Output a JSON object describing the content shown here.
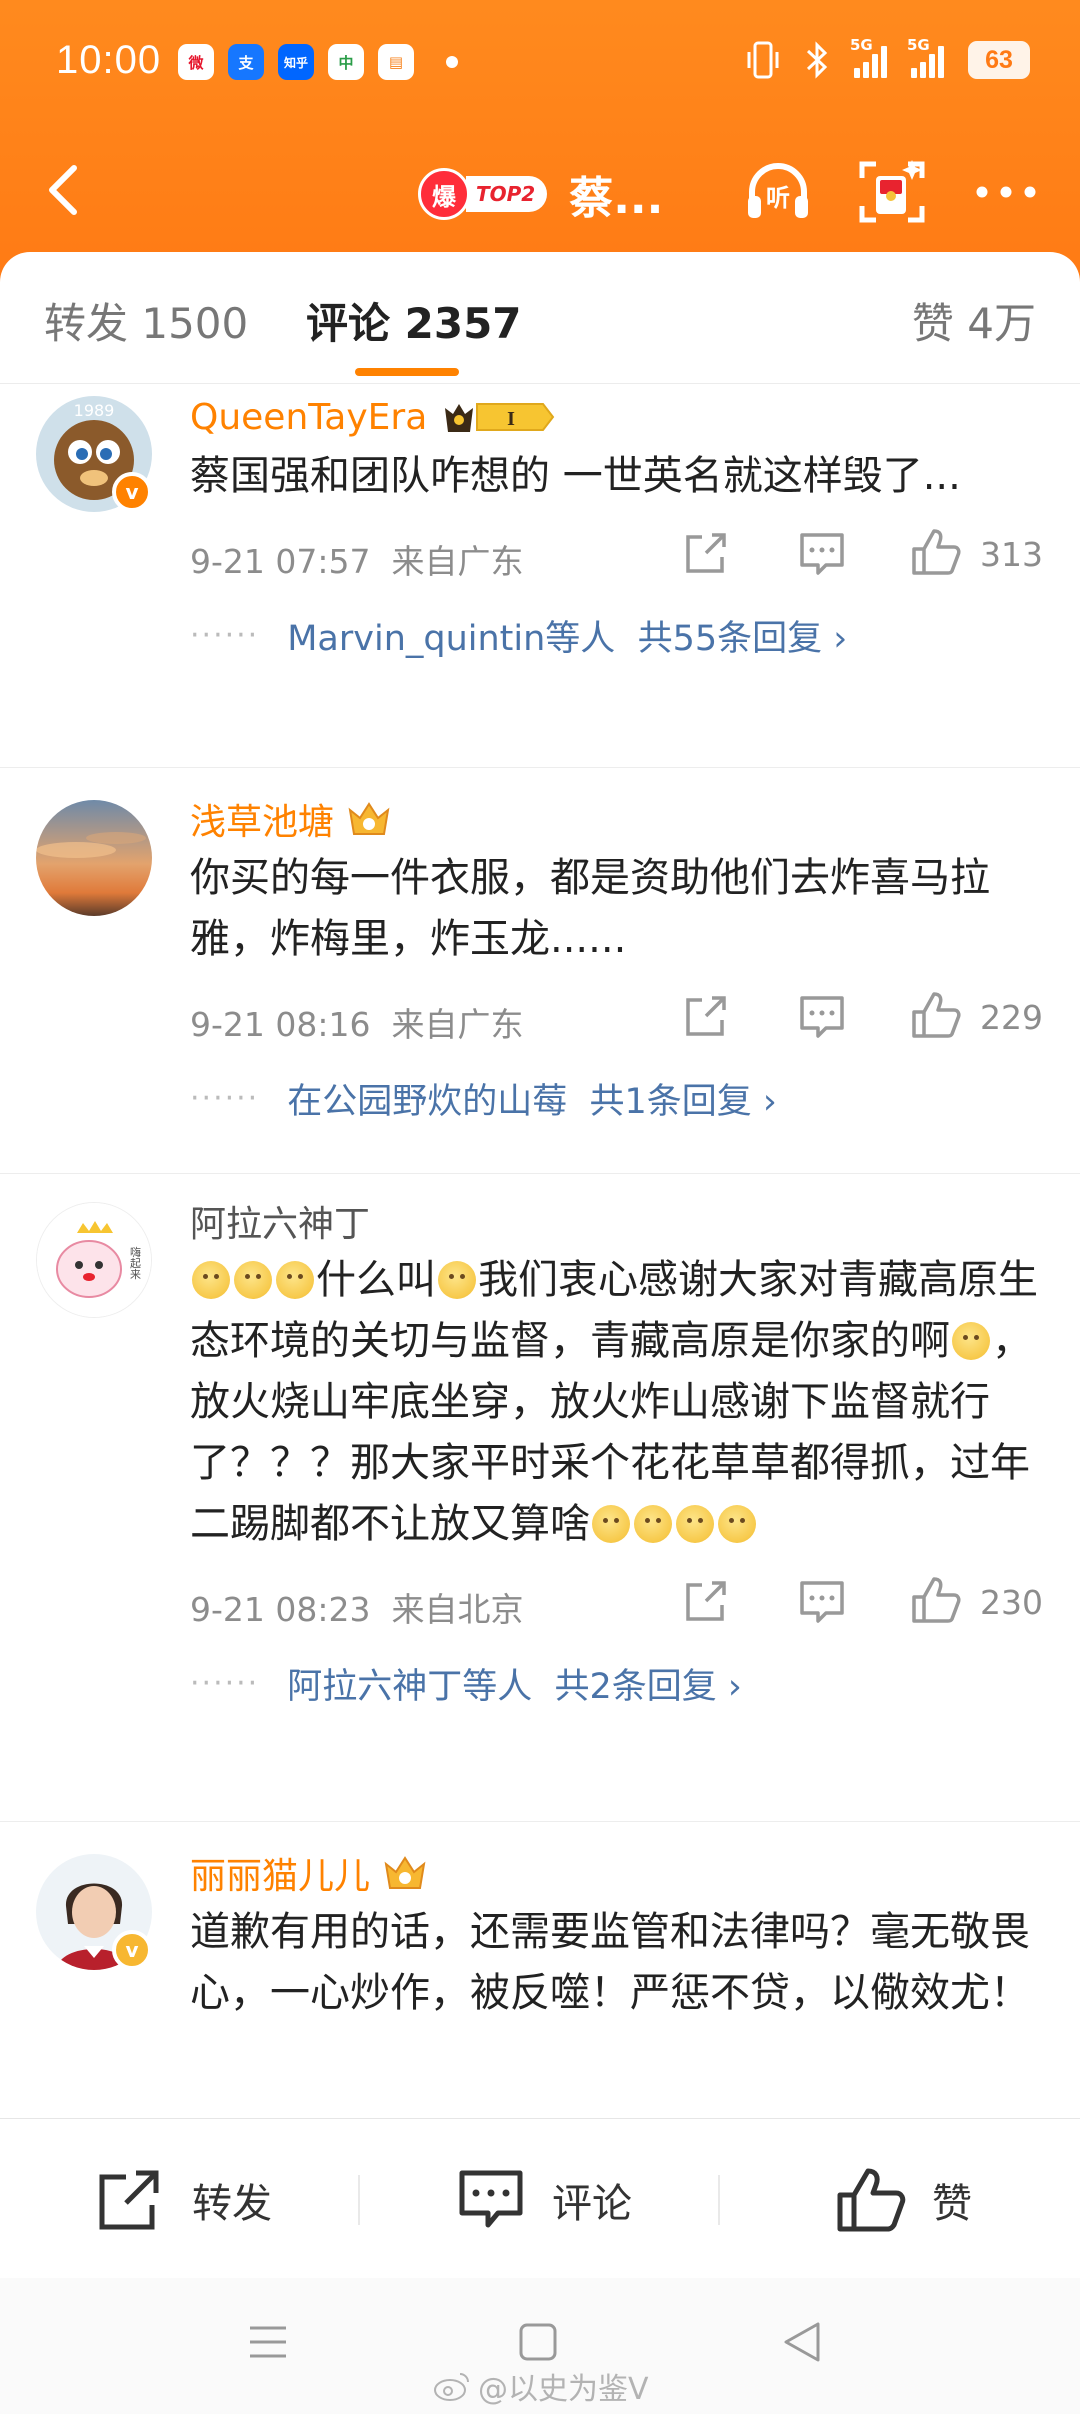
{
  "status_bar": {
    "time": "10:00",
    "apps": [
      {
        "name": "weibo-app-icon",
        "glyph": "微",
        "color": "#e6162d"
      },
      {
        "name": "alipay-app-icon",
        "glyph": "支",
        "color": "#1677ff"
      },
      {
        "name": "zhihu-app-icon",
        "glyph": "知乎",
        "color": "#0066ff"
      },
      {
        "name": "bank-app-icon",
        "glyph": "中",
        "color": "#2a9d48"
      },
      {
        "name": "video-app-icon",
        "glyph": "▤",
        "color": "#f7821b"
      }
    ],
    "signal1_label": "5G",
    "signal2_label": "5G",
    "battery": "63"
  },
  "nav": {
    "hot_badge": "爆",
    "rank_badge": "TOP2",
    "title": "蔡...",
    "accent": "#ff8200"
  },
  "tabs": {
    "repost": "转发 1500",
    "comments": "评论 2357",
    "likes": "赞 4万"
  },
  "comments": [
    {
      "user": "QueenTayEra",
      "text": "蔡国强和团队咋想的 一世英名就这样毁了...",
      "date": "9-21 07:57",
      "location": "来自广东",
      "likes": "313",
      "reply_users": "Marvin_quintin等人",
      "reply_count": "共55条回复 ›"
    },
    {
      "user": "浅草池塘",
      "text": "你买的每一件衣服，都是资助他们去炸喜马拉雅，炸梅里，炸玉龙......",
      "date": "9-21 08:16",
      "location": "来自广东",
      "likes": "229",
      "reply_users": "在公园野炊的山莓",
      "reply_count": "共1条回复 ›"
    },
    {
      "user": "阿拉六神丁",
      "avatar_caption": "嗨起来",
      "text_a": "什么叫",
      "text_b": "我们衷心感谢大家对青藏高原生态环境的关切与监督，青藏高原是你家的啊",
      "text_c": "，放火烧山牢底坐穿，放火炸山感谢下监督就行了？？？那大家平时采个花花草草都得抓，过年二踢脚都不让放又算啥",
      "date": "9-21 08:23",
      "location": "来自北京",
      "likes": "230",
      "reply_users": "阿拉六神丁等人",
      "reply_count": "共2条回复 ›"
    },
    {
      "user": "丽丽猫儿儿",
      "text": "道歉有用的话，还需要监管和法律吗？毫无敬畏心，一心炒作，被反噬！严惩不贷，以儆效尤！"
    }
  ],
  "actions": {
    "repost": "转发",
    "comment": "评论",
    "like": "赞"
  },
  "watermark": "@以史为鉴V"
}
